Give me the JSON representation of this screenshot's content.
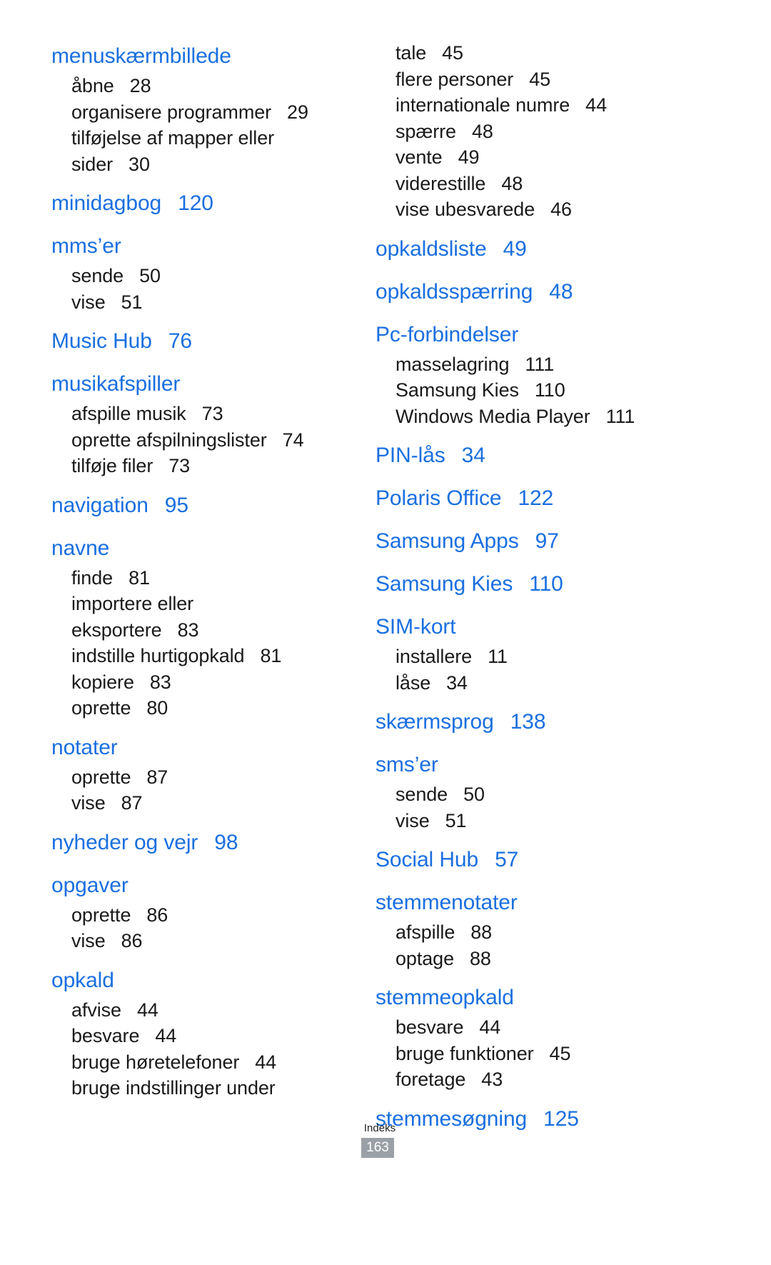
{
  "document": {
    "footer_label": "Indeks",
    "page_number": "163",
    "accent_color": "#1a6fe0",
    "text_color": "#1a1a1a",
    "page_badge_color": "#9aa0a6"
  },
  "columns": [
    {
      "entries": [
        {
          "term": "menuskærmbillede",
          "page": "",
          "subs": [
            {
              "term": "åbne",
              "page": "28"
            },
            {
              "term": "organisere programmer",
              "page": "29"
            },
            {
              "term": "tilføjelse af mapper eller",
              "page": ""
            },
            {
              "term": "sider",
              "page": "30"
            }
          ]
        },
        {
          "term": "minidagbog",
          "page": "120",
          "subs": []
        },
        {
          "term": "mms’er",
          "page": "",
          "subs": [
            {
              "term": "sende",
              "page": "50"
            },
            {
              "term": "vise",
              "page": "51"
            }
          ]
        },
        {
          "term": "Music Hub",
          "page": "76",
          "subs": []
        },
        {
          "term": "musikafspiller",
          "page": "",
          "subs": [
            {
              "term": "afspille musik",
              "page": "73"
            },
            {
              "term": "oprette afspilningslister",
              "page": "74"
            },
            {
              "term": "tilføje filer",
              "page": "73"
            }
          ]
        },
        {
          "term": "navigation",
          "page": "95",
          "subs": []
        },
        {
          "term": "navne",
          "page": "",
          "subs": [
            {
              "term": "finde",
              "page": "81"
            },
            {
              "term": "importere eller",
              "page": ""
            },
            {
              "term": "eksportere",
              "page": "83"
            },
            {
              "term": "indstille hurtigopkald",
              "page": "81"
            },
            {
              "term": "kopiere",
              "page": "83"
            },
            {
              "term": "oprette",
              "page": "80"
            }
          ]
        },
        {
          "term": "notater",
          "page": "",
          "subs": [
            {
              "term": "oprette",
              "page": "87"
            },
            {
              "term": "vise",
              "page": "87"
            }
          ]
        },
        {
          "term": "nyheder og vejr",
          "page": "98",
          "subs": []
        },
        {
          "term": "opgaver",
          "page": "",
          "subs": [
            {
              "term": "oprette",
              "page": "86"
            },
            {
              "term": "vise",
              "page": "86"
            }
          ]
        },
        {
          "term": "opkald",
          "page": "",
          "subs": [
            {
              "term": "afvise",
              "page": "44"
            },
            {
              "term": "besvare",
              "page": "44"
            },
            {
              "term": "bruge høretelefoner",
              "page": "44"
            },
            {
              "term": "bruge indstillinger under",
              "page": ""
            }
          ]
        }
      ]
    },
    {
      "entries": [
        {
          "term": "",
          "page": "",
          "continuation": true,
          "subs": [
            {
              "term": "tale",
              "page": "45"
            },
            {
              "term": "flere personer",
              "page": "45"
            },
            {
              "term": "internationale numre",
              "page": "44"
            },
            {
              "term": "spærre",
              "page": "48"
            },
            {
              "term": "vente",
              "page": "49"
            },
            {
              "term": "viderestille",
              "page": "48"
            },
            {
              "term": "vise ubesvarede",
              "page": "46"
            }
          ]
        },
        {
          "term": "opkaldsliste",
          "page": "49",
          "subs": []
        },
        {
          "term": "opkaldsspærring",
          "page": "48",
          "subs": []
        },
        {
          "term": "Pc-forbindelser",
          "page": "",
          "subs": [
            {
              "term": "masselagring",
              "page": "111"
            },
            {
              "term": "Samsung Kies",
              "page": "110"
            },
            {
              "term": "Windows Media Player",
              "page": "111"
            }
          ]
        },
        {
          "term": "PIN-lås",
          "page": "34",
          "subs": []
        },
        {
          "term": "Polaris Office",
          "page": "122",
          "subs": []
        },
        {
          "term": "Samsung Apps",
          "page": "97",
          "subs": []
        },
        {
          "term": "Samsung Kies",
          "page": "110",
          "subs": []
        },
        {
          "term": "SIM-kort",
          "page": "",
          "subs": [
            {
              "term": "installere",
              "page": "11"
            },
            {
              "term": "låse",
              "page": "34"
            }
          ]
        },
        {
          "term": "skærmsprog",
          "page": "138",
          "subs": []
        },
        {
          "term": "sms’er",
          "page": "",
          "subs": [
            {
              "term": "sende",
              "page": "50"
            },
            {
              "term": "vise",
              "page": "51"
            }
          ]
        },
        {
          "term": "Social Hub",
          "page": "57",
          "subs": []
        },
        {
          "term": "stemmenotater",
          "page": "",
          "subs": [
            {
              "term": "afspille",
              "page": "88"
            },
            {
              "term": "optage",
              "page": "88"
            }
          ]
        },
        {
          "term": "stemmeopkald",
          "page": "",
          "subs": [
            {
              "term": "besvare",
              "page": "44"
            },
            {
              "term": "bruge funktioner",
              "page": "45"
            },
            {
              "term": "foretage",
              "page": "43"
            }
          ]
        },
        {
          "term": "stemmesøgning",
          "page": "125",
          "subs": []
        }
      ]
    }
  ]
}
